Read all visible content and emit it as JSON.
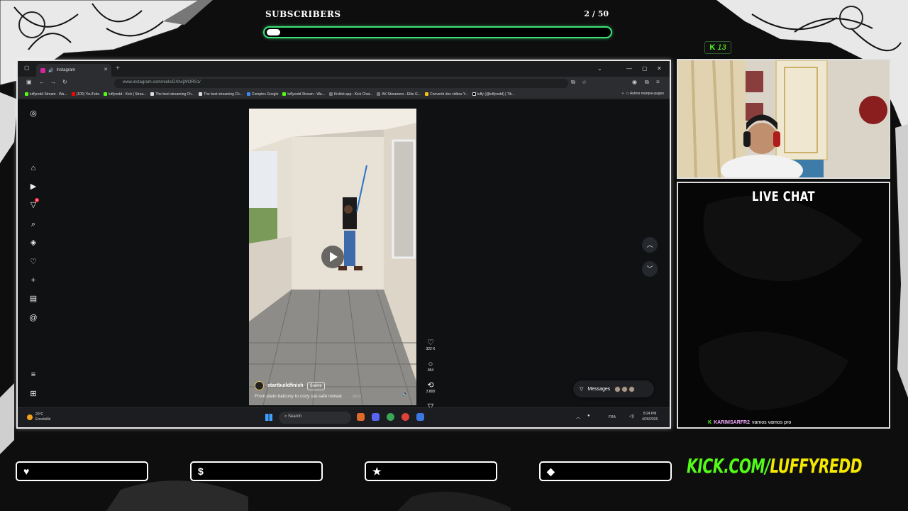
{
  "subscribers": {
    "title": "SUBSCRIBERS",
    "count": "2 / 50",
    "progress": 0.04
  },
  "kick_badge": {
    "count": "13"
  },
  "browser": {
    "tab_title": "Instagram",
    "url": "www.instagram.com/reels/DXhxjWORS1/",
    "bookmarks": [
      "luffyredd Stream - Wa...",
      "(100) YouTube",
      "luffyredd - Kick | Strea...",
      "The best streaming Ch...",
      "The best streaming Ch...",
      "Comptes Google",
      "luffyredd Stream - Wa...",
      "Kicklet.app - Kick Chat...",
      "AK Streamers - Elite G...",
      "Convertir des vidéos Y...",
      "luffy (@luffyredd) | Tik..."
    ],
    "bookmarks_more": "Autres marque-pages",
    "reel": {
      "author": "startbuildfinish",
      "follow_label": "Suivre",
      "caption": "From plain balcony to cozy cat-safe retreat",
      "more_label": "... plus",
      "likes": "322 K",
      "comments": "954",
      "reposts": "3 800"
    },
    "messages_label": "Messages",
    "notification_count": "6",
    "taskbar": {
      "temperature": "20°C",
      "weather_text": "Ensoleillé",
      "search_placeholder": "Search",
      "lang": "FRA",
      "time": "8:24 PM",
      "date": "4/26/2026"
    }
  },
  "chat": {
    "title": "LIVE CHAT",
    "messages": [
      {
        "user": "KARIMSARFR2",
        "text": "vamos vamos pro"
      }
    ]
  },
  "footer": {
    "stat_icons": [
      "heart-icon",
      "dollar-icon",
      "star-icon",
      "gem-icon"
    ],
    "kick_prefix": "KICK.COM/",
    "kick_user": "LUFFYREDD"
  },
  "colors": {
    "kick_green": "#53fc18",
    "goal_border": "#3ee07a",
    "channel_yellow": "#f5e800"
  }
}
